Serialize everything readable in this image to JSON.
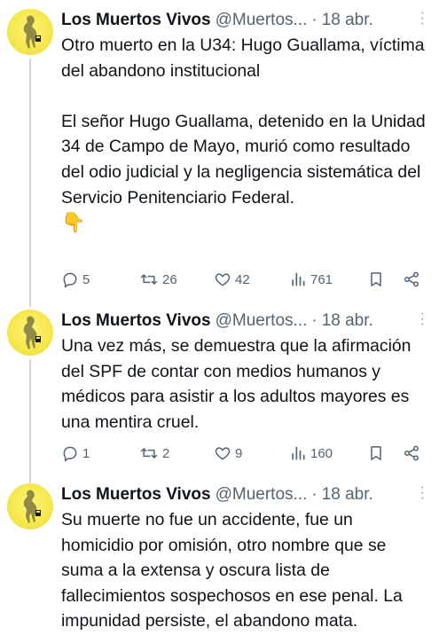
{
  "tweets": [
    {
      "name": "Los Muertos Vivos",
      "handle": "@Muertos...",
      "separator": "·",
      "date": "18 abr.",
      "text": "Otro muerto en la U34: Hugo Guallama, víctima del abandono institucional\n\nEl señor Hugo Guallama, detenido en la Unidad 34 de Campo de Mayo, murió como resultado del odio judicial y la negligencia sistemática del Servicio Penitenciario Federal.",
      "emoji": "👇",
      "replies": "5",
      "reposts": "26",
      "likes": "42",
      "views": "761"
    },
    {
      "name": "Los Muertos Vivos",
      "handle": "@Muertos...",
      "separator": "·",
      "date": "18 abr.",
      "text": "Una vez más, se demuestra que la afirmación del SPF de contar con medios humanos y médicos para asistir a los adultos mayores es una mentira cruel.",
      "replies": "1",
      "reposts": "2",
      "likes": "9",
      "views": "160"
    },
    {
      "name": "Los Muertos Vivos",
      "handle": "@Muertos...",
      "separator": "·",
      "date": "18 abr.",
      "text": "Su muerte no fue un accidente, fue un homicidio por omisión, otro nombre que se suma a la extensa y oscura lista de fallecimientos sospechosos en ese penal. La impunidad persiste, el abandono mata."
    }
  ],
  "icons": {
    "reply": "reply-icon",
    "repost": "repost-icon",
    "like": "heart-icon",
    "views": "views-icon",
    "bookmark": "bookmark-icon",
    "share": "share-icon",
    "more": "more-options-icon"
  },
  "colors": {
    "text": "#0f1419",
    "secondary": "#536471",
    "thread_line": "#cfd9de",
    "avatar_bg": "#f6e84f"
  }
}
